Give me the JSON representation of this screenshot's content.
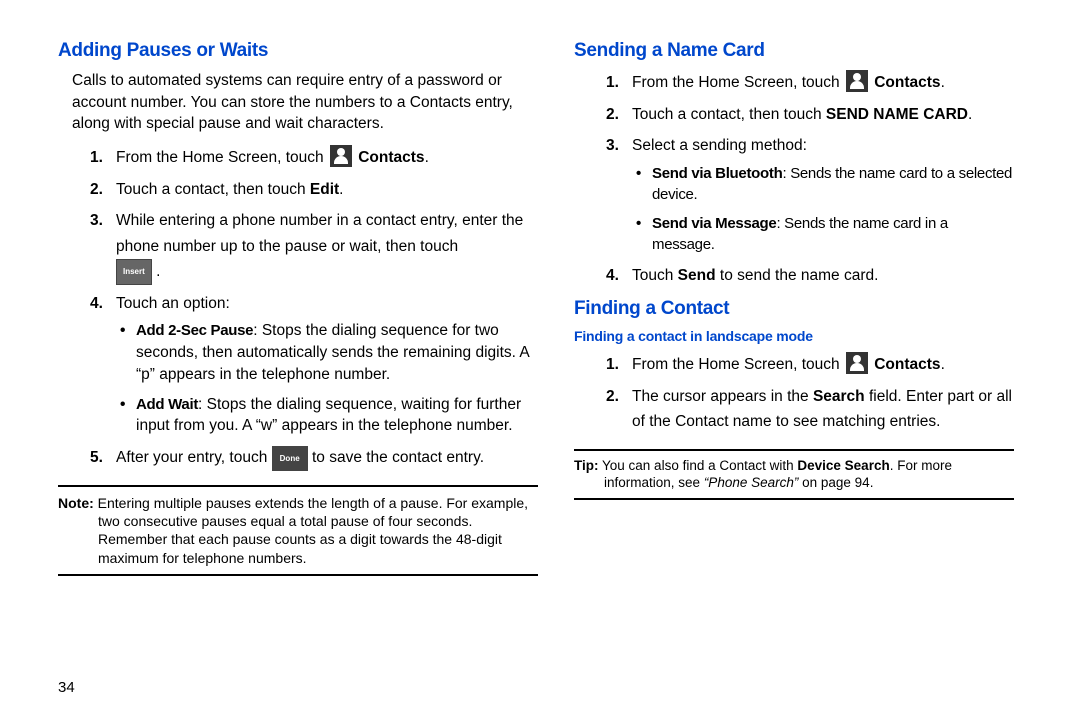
{
  "pageNumber": "34",
  "left": {
    "h2": "Adding Pauses or Waits",
    "intro": "Calls to automated systems can require entry of a password or account number. You can store the numbers to a Contacts entry, along with special pause and wait characters.",
    "s1a": "From the Home Screen, touch ",
    "s1b": "Contacts",
    "s1c": ".",
    "s2a": "Touch a contact, then touch ",
    "s2b": "Edit",
    "s2c": ".",
    "s3": "While entering a phone number in a contact entry, enter the phone number up to the pause or wait, then touch",
    "insert": "Insert",
    "s3end": ".",
    "s4": "Touch an option:",
    "b1label": "Add 2-Sec Pause",
    "b1text": ": Stops the dialing sequence for two seconds, then automatically sends the remaining digits. A “p” appears in the telephone number.",
    "b2label": "Add Wait",
    "b2text": ": Stops the dialing sequence, waiting for further input from you. A “w” appears in the telephone number.",
    "s5a": "After your entry, touch ",
    "done": "Done",
    "s5b": " to save the contact entry.",
    "noteLabel": "Note:",
    "noteText": " Entering multiple pauses extends the length of a pause. For example, two consecutive pauses equal a total pause of four seconds. Remember that each pause counts as a digit towards the 48-digit maximum for telephone numbers."
  },
  "right": {
    "h2a": "Sending a Name Card",
    "r1a": "From the Home Screen, touch ",
    "r1b": "Contacts",
    "r1c": ".",
    "r2a": "Touch a contact, then touch ",
    "r2b": "SEND NAME CARD",
    "r2c": ".",
    "r3": "Select a sending method:",
    "rb1label": "Send via Bluetooth",
    "rb1text": ": Sends the name card to a selected device.",
    "rb2label": "Send via Message",
    "rb2text": ": Sends the name card in a message.",
    "r4a": "Touch ",
    "r4b": "Send",
    "r4c": " to send the name card.",
    "h2b": "Finding a Contact",
    "h3": "Finding a contact in landscape mode",
    "f1a": "From the Home Screen, touch ",
    "f1b": "Contacts",
    "f1c": ".",
    "f2a": "The cursor appears in the ",
    "f2b": "Search",
    "f2c": " field. Enter part or all of the Contact name to see matching entries.",
    "tipLabel": "Tip:",
    "tipA": "  You can also find a Contact with ",
    "tipB": "Device Search",
    "tipC": ". For more information, see ",
    "tipItal": "“Phone Search”",
    "tipD": " on page 94."
  }
}
